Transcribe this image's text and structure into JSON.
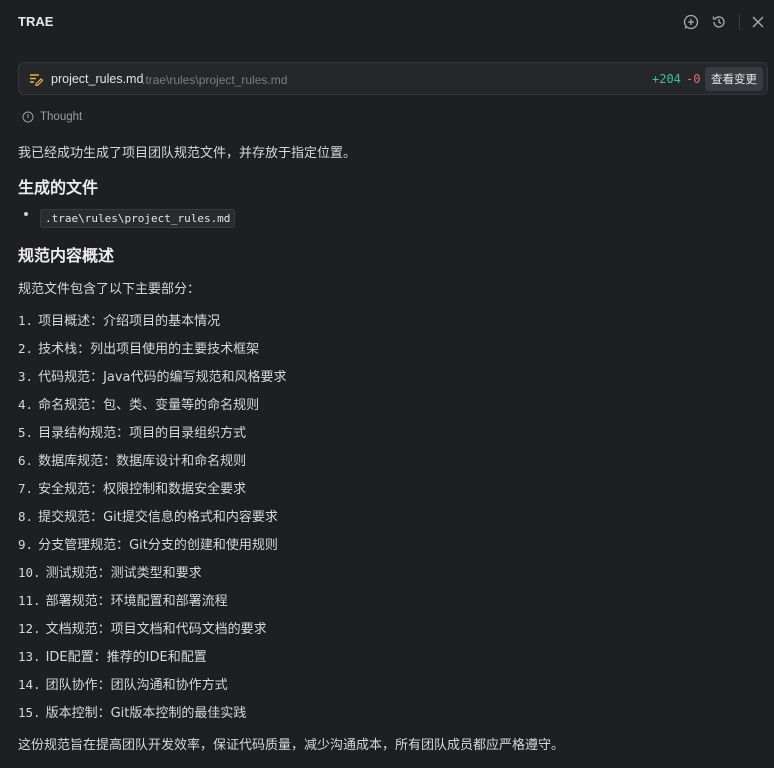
{
  "app": {
    "title": "TRAE"
  },
  "file": {
    "name": "project_rules.md",
    "path": ".trae\\rules\\project_rules.md",
    "added": "+204",
    "removed": "-0",
    "view_label": "查看变更"
  },
  "thought_label": "Thought",
  "intro": "我已经成功生成了项目团队规范文件，并存放于指定位置。",
  "section1_title": "生成的文件",
  "generated_file": ".trae\\rules\\project_rules.md",
  "section2_title": "规范内容概述",
  "overview_intro": "规范文件包含了以下主要部分：",
  "items": [
    {
      "num": "1.",
      "text": "项目概述：介绍项目的基本情况"
    },
    {
      "num": "2.",
      "text": "技术栈：列出项目使用的主要技术框架"
    },
    {
      "num": "3.",
      "text": "代码规范：Java代码的编写规范和风格要求"
    },
    {
      "num": "4.",
      "text": "命名规范：包、类、变量等的命名规则"
    },
    {
      "num": "5.",
      "text": "目录结构规范：项目的目录组织方式"
    },
    {
      "num": "6.",
      "text": "数据库规范：数据库设计和命名规则"
    },
    {
      "num": "7.",
      "text": "安全规范：权限控制和数据安全要求"
    },
    {
      "num": "8.",
      "text": "提交规范：Git提交信息的格式和内容要求"
    },
    {
      "num": "9.",
      "text": "分支管理规范：Git分支的创建和使用规则"
    },
    {
      "num": "10.",
      "text": "测试规范：测试类型和要求"
    },
    {
      "num": "11.",
      "text": "部署规范：环境配置和部署流程"
    },
    {
      "num": "12.",
      "text": "文档规范：项目文档和代码文档的要求"
    },
    {
      "num": "13.",
      "text": "IDE配置：推荐的IDE和配置"
    },
    {
      "num": "14.",
      "text": "团队协作：团队沟通和协作方式"
    },
    {
      "num": "15.",
      "text": "版本控制：Git版本控制的最佳实践"
    }
  ],
  "closing": "这份规范旨在提高团队开发效率，保证代码质量，减少沟通成本，所有团队成员都应严格遵守。",
  "colors": {
    "background": "#1e1f22",
    "added": "#3fc18a",
    "removed": "#e06c6c"
  }
}
